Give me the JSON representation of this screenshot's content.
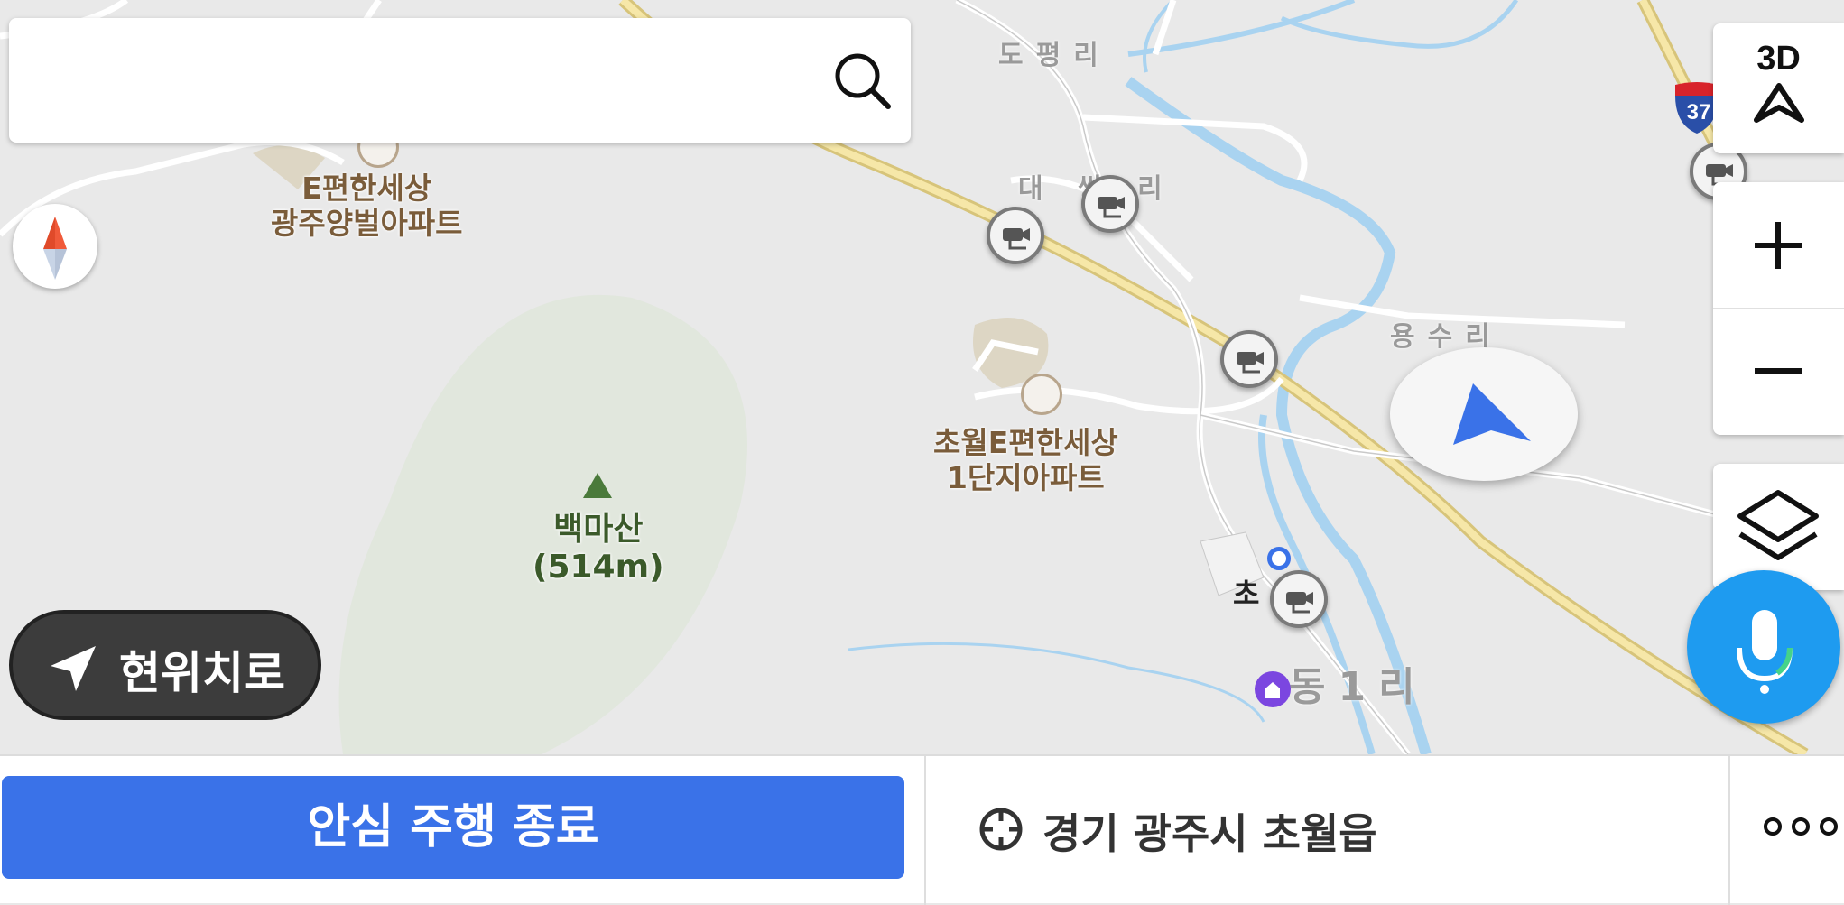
{
  "search": {
    "placeholder": "",
    "icon": "search-icon"
  },
  "map": {
    "labels": {
      "apt1_line1": "E편한세상",
      "apt1_line2": "광주양벌아파트",
      "apt2_line1": "초월E편한세상",
      "apt2_line2": "1단지아파트",
      "mountain_name": "백마산",
      "mountain_height": "(514m)",
      "village_dopyeong": "도평리",
      "village_dae": "대 쌍 리",
      "village_yongsu": "용수리",
      "village_dong1": "동1리",
      "partial_cho": "초",
      "highway_shield": "37"
    },
    "colors": {
      "road_highway": "#f3dd8c",
      "water": "#a9d3f0",
      "land": "#e9e9e9"
    }
  },
  "controls": {
    "btn_3d": "3D",
    "current_location": "현위치로"
  },
  "bottom_bar": {
    "end_button": "안심 주행 종료",
    "address": "경기 광주시 초월읍",
    "accent": "#3a72e8"
  }
}
